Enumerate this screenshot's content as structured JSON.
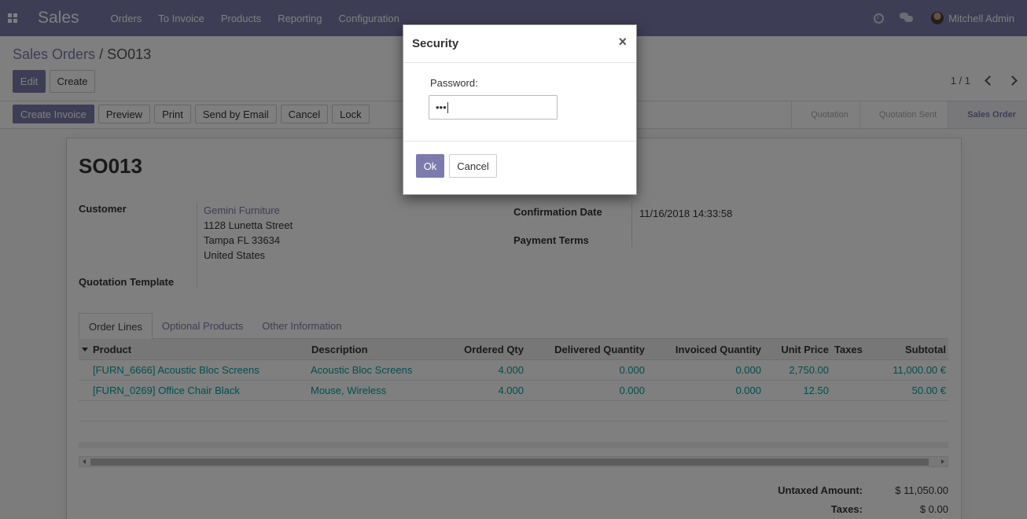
{
  "navbar": {
    "brand": "Sales",
    "menu": [
      "Orders",
      "To Invoice",
      "Products",
      "Reporting",
      "Configuration"
    ],
    "user": "Mitchell Admin"
  },
  "control_panel": {
    "breadcrumb_parent": "Sales Orders",
    "breadcrumb_sep": "/",
    "breadcrumb_current": "SO013",
    "edit_label": "Edit",
    "create_label": "Create",
    "pager": "1 / 1"
  },
  "statusbar": {
    "buttons": [
      "Create Invoice",
      "Preview",
      "Print",
      "Send by Email",
      "Cancel",
      "Lock"
    ],
    "stages": [
      "Quotation",
      "Quotation Sent",
      "Sales Order"
    ],
    "active_stage": "Sales Order"
  },
  "record": {
    "name": "SO013",
    "customer_label": "Customer",
    "customer_name": "Gemini Furniture",
    "address_line1": "1128 Lunetta Street",
    "address_line2": "Tampa FL 33634",
    "address_line3": "United States",
    "template_label": "Quotation Template",
    "confirmation_label": "Confirmation Date",
    "confirmation_value": "11/16/2018 14:33:58",
    "payment_terms_label": "Payment Terms"
  },
  "tabs": [
    "Order Lines",
    "Optional Products",
    "Other Information"
  ],
  "table": {
    "headers": [
      "Product",
      "Description",
      "Ordered Qty",
      "Delivered Quantity",
      "Invoiced Quantity",
      "Unit Price",
      "Taxes",
      "Subtotal"
    ],
    "rows": [
      [
        "[FURN_6666] Acoustic Bloc Screens",
        "Acoustic Bloc Screens",
        "4.000",
        "0.000",
        "0.000",
        "2,750.00",
        "",
        "11,000.00 €"
      ],
      [
        "[FURN_0269] Office Chair Black",
        "Mouse, Wireless",
        "4.000",
        "0.000",
        "0.000",
        "12.50",
        "",
        "50.00 €"
      ]
    ]
  },
  "totals": {
    "untaxed_label": "Untaxed Amount:",
    "untaxed_value": "$ 11,050.00",
    "taxes_label": "Taxes:",
    "taxes_value": "$ 0.00"
  },
  "dialog": {
    "title": "Security",
    "close": "×",
    "password_label": "Password:",
    "password_value": "•••",
    "ok_label": "Ok",
    "cancel_label": "Cancel"
  }
}
